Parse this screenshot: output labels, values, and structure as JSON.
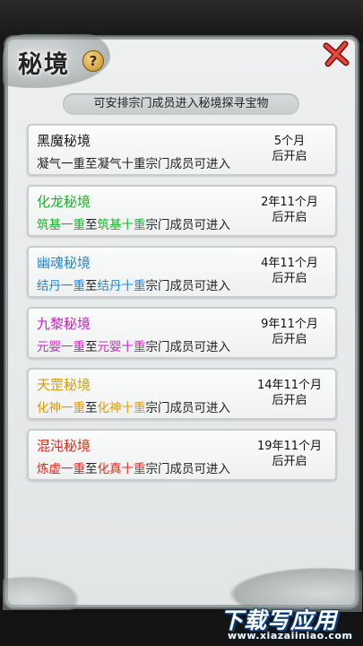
{
  "header": {
    "title": "秘境",
    "help_icon": "question-mark-icon",
    "help_glyph": "?",
    "close_icon": "close-x-icon"
  },
  "subtitle": "可安排宗门成员进入秘境探寻宝物",
  "realms": [
    {
      "name": "黑魔秘境",
      "name_color": "#1a1a1a",
      "rank_start": "凝气一重",
      "connector": "至",
      "rank_end": "凝气十重",
      "rank_color": "#222222",
      "suffix": "宗门成员可进入",
      "time_line1": "5个月",
      "time_line2": "后开启"
    },
    {
      "name": "化龙秘境",
      "name_color": "#18b428",
      "rank_start": "筑基一重",
      "connector": "至",
      "rank_end": "筑基十重",
      "rank_color": "#18b428",
      "suffix": "宗门成员可进入",
      "time_line1": "2年11个月",
      "time_line2": "后开启"
    },
    {
      "name": "幽魂秘境",
      "name_color": "#2288cc",
      "rank_start": "结丹一重",
      "connector": "至",
      "rank_end": "结丹十重",
      "rank_color": "#2288cc",
      "suffix": "宗门成员可进入",
      "time_line1": "4年11个月",
      "time_line2": "后开启"
    },
    {
      "name": "九黎秘境",
      "name_color": "#d020c8",
      "rank_start": "元婴一重",
      "connector": "至",
      "rank_end": "元婴十重",
      "rank_color": "#d020c8",
      "suffix": "宗门成员可进入",
      "time_line1": "9年11个月",
      "time_line2": "后开启"
    },
    {
      "name": "天罡秘境",
      "name_color": "#e09a00",
      "rank_start": "化神一重",
      "connector": "至",
      "rank_end": "化神十重",
      "rank_color": "#e09a00",
      "suffix": "宗门成员可进入",
      "time_line1": "14年11个月",
      "time_line2": "后开启"
    },
    {
      "name": "混沌秘境",
      "name_color": "#e02a18",
      "rank_start": "炼虚一重",
      "connector": "至",
      "rank_end": "化真十重",
      "rank_color": "#e02a18",
      "suffix": "宗门成员可进入",
      "time_line1": "19年11个月",
      "time_line2": "后开启"
    }
  ],
  "watermark": {
    "title": "下载写应用",
    "url": "www.xiazaiiniao.com"
  }
}
